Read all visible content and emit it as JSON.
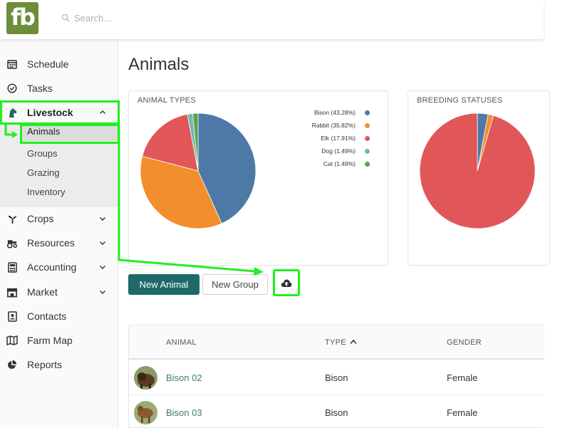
{
  "app": {
    "logo_text": "fb"
  },
  "search": {
    "placeholder": "Search..."
  },
  "sidebar": {
    "items": [
      {
        "label": "Schedule",
        "icon": "calendar-icon"
      },
      {
        "label": "Tasks",
        "icon": "check-circle-icon"
      },
      {
        "label": "Livestock",
        "icon": "horse-head-icon"
      },
      {
        "label": "Crops",
        "icon": "sprout-icon"
      },
      {
        "label": "Resources",
        "icon": "tractor-icon"
      },
      {
        "label": "Accounting",
        "icon": "calculator-icon"
      },
      {
        "label": "Market",
        "icon": "store-icon"
      },
      {
        "label": "Contacts",
        "icon": "address-book-icon"
      },
      {
        "label": "Farm Map",
        "icon": "map-icon"
      },
      {
        "label": "Reports",
        "icon": "pie-chart-icon"
      }
    ],
    "livestock_sub": [
      {
        "label": "Animals"
      },
      {
        "label": "Groups"
      },
      {
        "label": "Grazing"
      },
      {
        "label": "Inventory"
      }
    ]
  },
  "main": {
    "title": "Animals",
    "buttons": {
      "new_animal": "New Animal",
      "new_group": "New Group",
      "upload_icon": "cloud-upload-icon"
    },
    "table": {
      "headers": {
        "animal": "ANIMAL",
        "type": "TYPE",
        "gender": "GENDER"
      },
      "rows": [
        {
          "name": "Bison 02",
          "type": "Bison",
          "gender": "Female"
        },
        {
          "name": "Bison 03",
          "type": "Bison",
          "gender": "Female"
        }
      ]
    }
  },
  "colors": {
    "primary": "#1d6a68",
    "logo": "#6d8c3c",
    "highlight": "#22ee22"
  },
  "chart_data": [
    {
      "type": "pie",
      "title": "ANIMAL TYPES",
      "categories": [
        "Bison (43.28%)",
        "Rabbit (35.82%)",
        "Elk (17.91%)",
        "Dog (1.49%)",
        "Cat (1.49%)"
      ],
      "values": [
        43.28,
        35.82,
        17.91,
        1.49,
        1.49
      ],
      "colors": [
        "#4e79a7",
        "#f28e2b",
        "#e15759",
        "#76b7b2",
        "#59a14f"
      ],
      "legend": "right"
    },
    {
      "type": "pie",
      "title": "BREEDING STATUSES",
      "values": [
        3,
        1.5,
        95.5
      ],
      "colors": [
        "#4e79a7",
        "#f28e2b",
        "#e15759"
      ]
    }
  ]
}
